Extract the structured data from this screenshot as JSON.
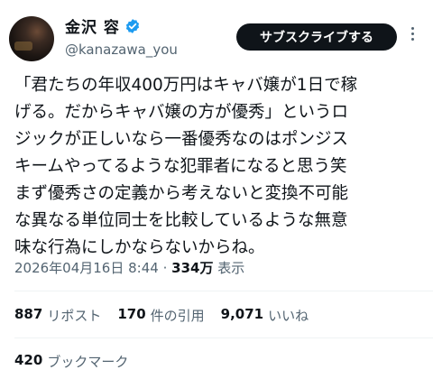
{
  "author": {
    "name": "金沢 容",
    "handle": "@kanazawa_you",
    "verified": true,
    "badge_color": "#1d9bf0"
  },
  "subscribe_label": "サブスクライブする",
  "tweet": {
    "lines": [
      "「君たちの年収400万円はキャバ嬢が1日で稼",
      "げる。だからキャバ嬢の方が優秀」というロ",
      "ジックが正しいなら一番優秀なのはポンジス",
      "キームやってるような犯罪者になると思う笑",
      "まず優秀さの定義から考えないと変換不可能",
      "な異なる単位同士を比較しているような無意",
      "味な行為にしかならないからね。"
    ]
  },
  "meta": {
    "datetime": "2026年04月16日 8:44",
    "separator": "·",
    "views_count": "334万",
    "views_label": "表示"
  },
  "stats": {
    "reposts_count": "887",
    "reposts_label": "リポスト",
    "quotes_count": "170",
    "quotes_label": "件の引用",
    "likes_count": "9,071",
    "likes_label": "いいね",
    "bookmarks_count": "420",
    "bookmarks_label": "ブックマーク"
  }
}
